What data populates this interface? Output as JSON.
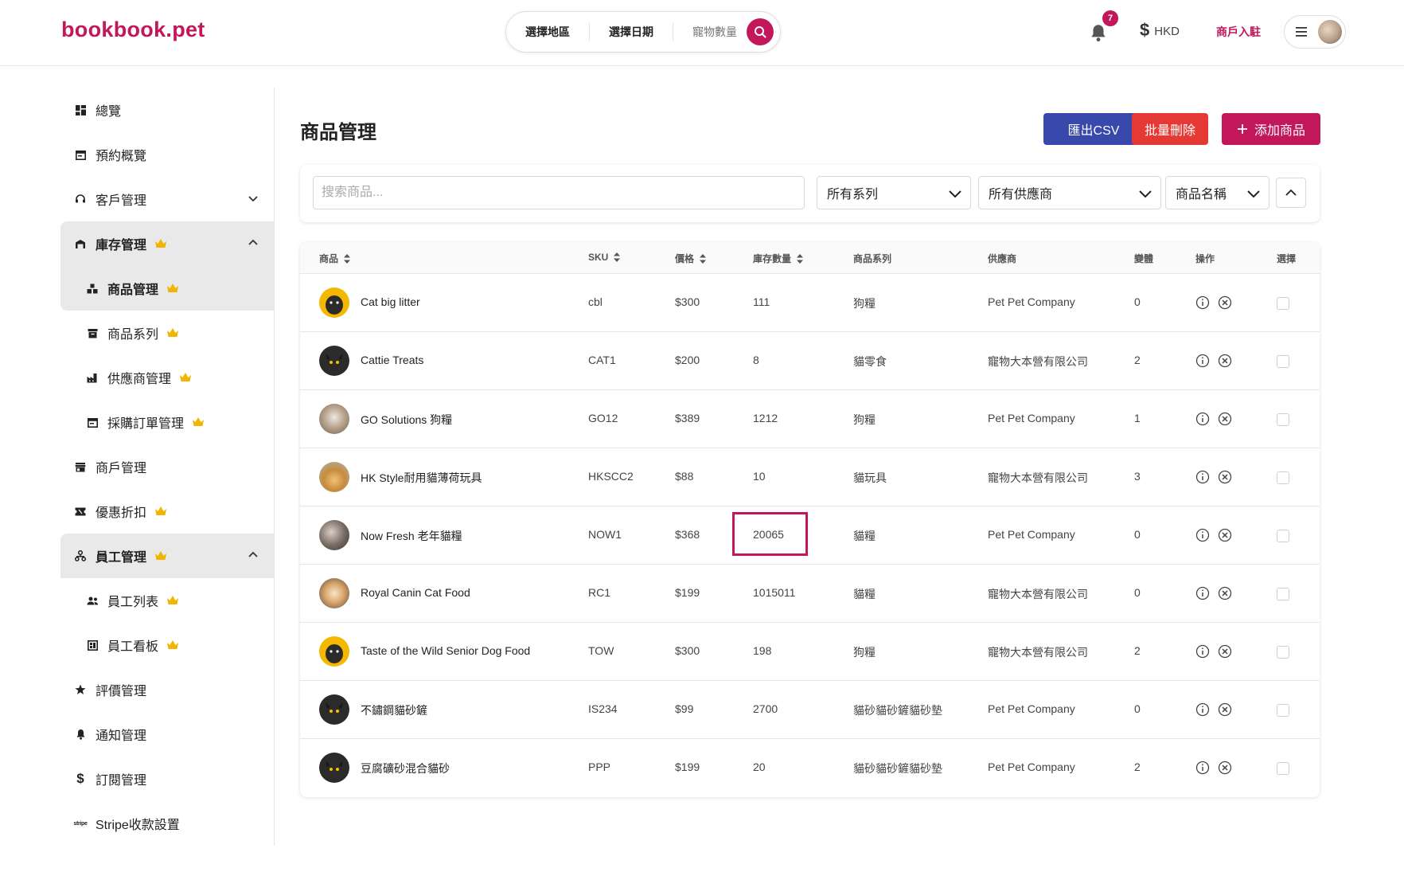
{
  "header": {
    "logo": "bookbook.pet",
    "search": {
      "area": "選擇地區",
      "date": "選擇日期",
      "pets": "寵物數量"
    },
    "notifications_count": "7",
    "currency": "HKD",
    "merchant_join": "商戶入駐",
    "accent_color": "#c2185b"
  },
  "sidebar": {
    "overview": "總覽",
    "booking_overview": "預約概覽",
    "customer_mgmt": "客戶管理",
    "inventory_mgmt": "庫存管理",
    "product_mgmt": "商品管理",
    "product_series": "商品系列",
    "supplier_mgmt": "供應商管理",
    "purchase_orders": "採購訂單管理",
    "merchant_mgmt": "商戶管理",
    "discounts": "優惠折扣",
    "staff_mgmt": "員工管理",
    "staff_list": "員工列表",
    "staff_board": "員工看板",
    "reviews_mgmt": "評價管理",
    "notifications_mgmt": "通知管理",
    "subscriptions_mgmt": "訂閱管理",
    "stripe_settings": "Stripe收款設置"
  },
  "main": {
    "title": "商品管理",
    "buttons": {
      "export_csv": "匯出CSV",
      "bulk_delete": "批量刪除",
      "add_product": "添加商品"
    },
    "filters": {
      "search_placeholder": "搜索商品...",
      "series": "所有系列",
      "supplier": "所有供應商",
      "sort_by": "商品名稱"
    },
    "table": {
      "headers": {
        "product": "商品",
        "sku": "SKU",
        "price": "價格",
        "stock": "庫存數量",
        "series": "商品系列",
        "supplier": "供應商",
        "variants": "變體",
        "actions": "操作",
        "select": "選擇"
      },
      "rows": [
        {
          "name": "Cat big litter",
          "sku": "cbl",
          "price": "$300",
          "stock": "111",
          "series": "狗糧",
          "supplier": "Pet Pet Company",
          "variants": "0",
          "thumb": "pug"
        },
        {
          "name": "Cattie Treats",
          "sku": "CAT1",
          "price": "$200",
          "stock": "8",
          "series": "貓零食",
          "supplier": "寵物大本營有限公司",
          "variants": "2",
          "thumb": "blackcat"
        },
        {
          "name": "GO Solutions 狗糧",
          "sku": "GO12",
          "price": "$389",
          "stock": "1212",
          "series": "狗糧",
          "supplier": "Pet Pet Company",
          "variants": "1",
          "thumb": "photo1"
        },
        {
          "name": "HK Style耐用貓薄荷玩具",
          "sku": "HKSCC2",
          "price": "$88",
          "stock": "10",
          "series": "貓玩具",
          "supplier": "寵物大本營有限公司",
          "variants": "3",
          "thumb": "photo2"
        },
        {
          "name": "Now Fresh 老年貓糧",
          "sku": "NOW1",
          "price": "$368",
          "stock": "20065",
          "series": "貓糧",
          "supplier": "Pet Pet Company",
          "variants": "0",
          "thumb": "photo3"
        },
        {
          "name": "Royal Canin Cat Food",
          "sku": "RC1",
          "price": "$199",
          "stock": "1015011",
          "series": "貓糧",
          "supplier": "寵物大本營有限公司",
          "variants": "0",
          "thumb": "photo4"
        },
        {
          "name": "Taste of the Wild Senior Dog Food",
          "sku": "TOW",
          "price": "$300",
          "stock": "198",
          "series": "狗糧",
          "supplier": "寵物大本營有限公司",
          "variants": "2",
          "thumb": "pug"
        },
        {
          "name": "不鏽鋼貓砂鏟",
          "sku": "IS234",
          "price": "$99",
          "stock": "2700",
          "series": "貓砂貓砂鏟貓砂墊",
          "supplier": "Pet Pet Company",
          "variants": "0",
          "thumb": "blackcat"
        },
        {
          "name": "豆腐礦砂混合貓砂",
          "sku": "PPP",
          "price": "$199",
          "stock": "20",
          "series": "貓砂貓砂鏟貓砂墊",
          "supplier": "Pet Pet Company",
          "variants": "2",
          "thumb": "blackcat"
        }
      ]
    }
  }
}
